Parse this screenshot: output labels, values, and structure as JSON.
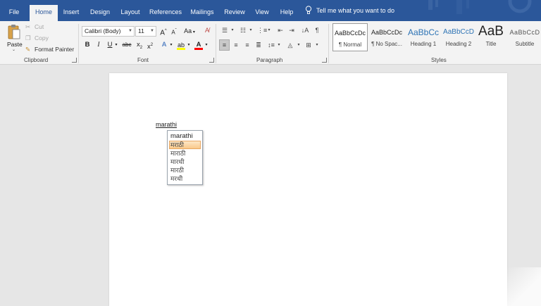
{
  "tabs": [
    "File",
    "Home",
    "Insert",
    "Design",
    "Layout",
    "References",
    "Mailings",
    "Review",
    "View",
    "Help"
  ],
  "active_tab": "Home",
  "tell_me": "Tell me what you want to do",
  "clipboard": {
    "paste": "Paste",
    "cut": "Cut",
    "copy": "Copy",
    "format_painter": "Format Painter",
    "label": "Clipboard"
  },
  "font": {
    "name": "Calibri (Body)",
    "size": "11",
    "grow": "A",
    "shrink": "A",
    "change_case": "Aa",
    "bold": "B",
    "italic": "I",
    "underline": "U",
    "strikethrough": "abc",
    "subscript": "x",
    "superscript": "x",
    "label": "Font",
    "highlight_color": "#ffff00",
    "font_color": "#ff0000"
  },
  "paragraph": {
    "label": "Paragraph"
  },
  "styles": {
    "label": "Styles",
    "items": [
      {
        "preview": "AaBbCcDc",
        "name": "¶ Normal"
      },
      {
        "preview": "AaBbCcDc",
        "name": "¶ No Spac..."
      },
      {
        "preview": "AaBbCc",
        "name": "Heading 1"
      },
      {
        "preview": "AaBbCcD",
        "name": "Heading 2"
      },
      {
        "preview": "AaB",
        "name": "Title"
      },
      {
        "preview": "AaBbCcD",
        "name": "Subtitle"
      }
    ]
  },
  "document": {
    "typed_text": "marathi"
  },
  "ime": {
    "input": "marathi",
    "candidates": [
      "मराठी",
      "माराठी",
      "मारथी",
      "मारठी",
      "मरथी"
    ]
  },
  "colors": {
    "ribbon_blue": "#2b579a"
  }
}
